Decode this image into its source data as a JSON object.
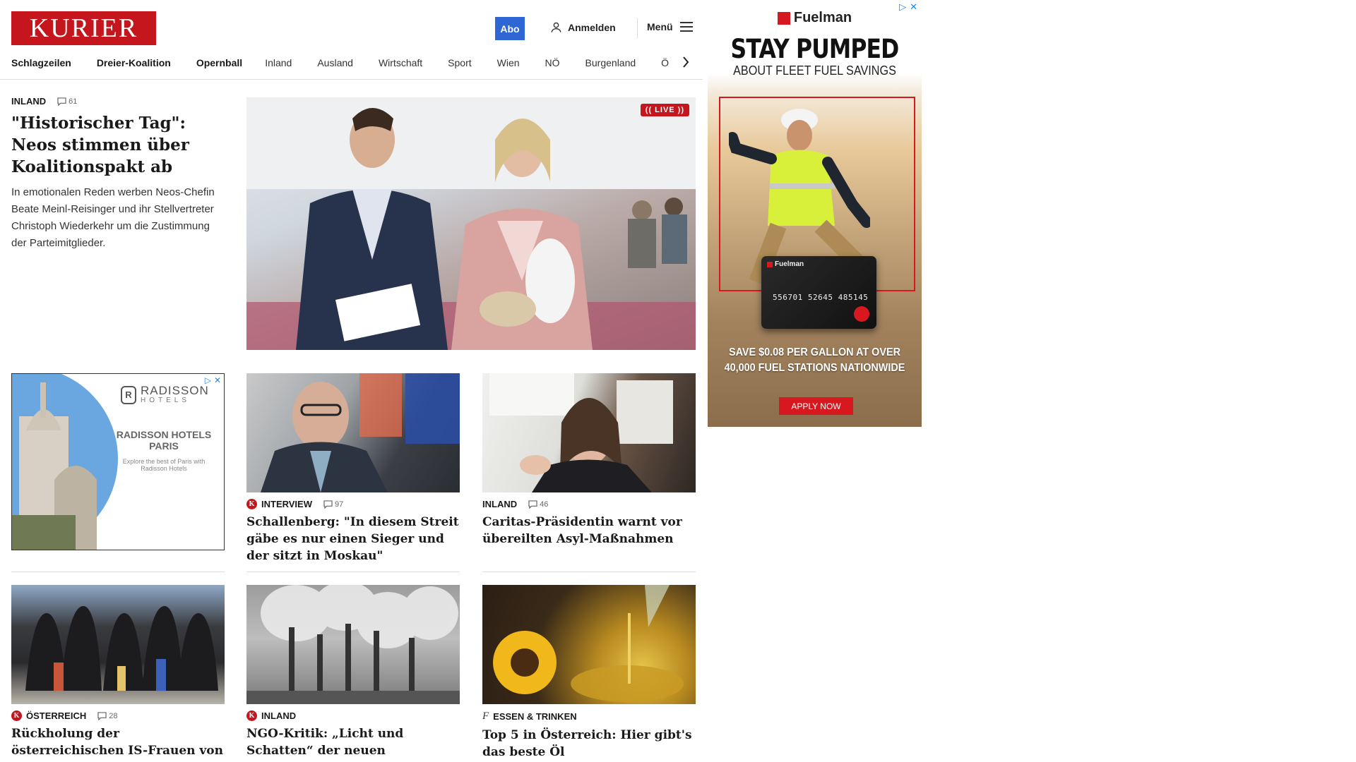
{
  "header": {
    "logo_text": "KURIER",
    "abo_label": "Abo",
    "login_label": "Anmelden",
    "menu_label": "Menü",
    "brand_color": "#c4161c",
    "abo_color": "#2e67d3"
  },
  "nav": {
    "items": [
      "Schlagzeilen",
      "Dreier-Koalition",
      "Opernball",
      "Inland",
      "Ausland",
      "Wirtschaft",
      "Sport",
      "Wien",
      "NÖ",
      "Burgenland",
      "Ö"
    ]
  },
  "lead": {
    "kicker": "INLAND",
    "comments": "61",
    "headline": "\"Historischer Tag\": Neos stimmen über Koalitionspakt ab",
    "teaser": "In emotionalen Reden werben Neos-Chefin Beate Meinl-Reisinger und ihr Stellvertreter Christoph Wiederkehr um die Zustimmung der Parteimitglieder.",
    "live_label": "(( LIVE ))"
  },
  "ad_radisson": {
    "brand": "RADISSON",
    "brand_sub": "HOTELS",
    "title": "RADISSON HOTELS PARIS",
    "text": "Explore the best of Paris with Radisson Hotels"
  },
  "articles": [
    {
      "kicker": "INTERVIEW",
      "badge": "K",
      "comments": "97",
      "headline": "Schallenberg: \"In diesem Streit gäbe es nur einen Sieger und der sitzt in Moskau\""
    },
    {
      "kicker": "INLAND",
      "badge": "",
      "comments": "46",
      "headline": "Caritas-Präsidentin warnt vor übereilten Asyl-Maßnahmen"
    },
    {
      "kicker": "ÖSTERREICH",
      "badge": "K",
      "comments": "28",
      "headline": "Rückholung der österreichischen IS-Frauen von langer Hand geplant"
    },
    {
      "kicker": "INLAND",
      "badge": "K",
      "comments": "",
      "headline": "NGO-Kritik: „Licht und Schatten“ der neuen Klimapolitik"
    },
    {
      "kicker": "ESSEN & TRINKEN",
      "badge": "f",
      "comments": "",
      "headline": "Top 5 in Österreich: Hier gibt's das beste Öl"
    }
  ],
  "ad_fuelman": {
    "brand": "Fuelman",
    "headline": "STAY PUMPED",
    "sub": "ABOUT FLEET FUEL SAVINGS",
    "card_brand": "Fuelman",
    "card_number": "556701 52645 485145",
    "save_text": "SAVE $0.08 PER GALLON AT OVER 40,000 FUEL STATIONS NATIONWIDE",
    "cta": "APPLY NOW",
    "accent": "#d7191f"
  }
}
